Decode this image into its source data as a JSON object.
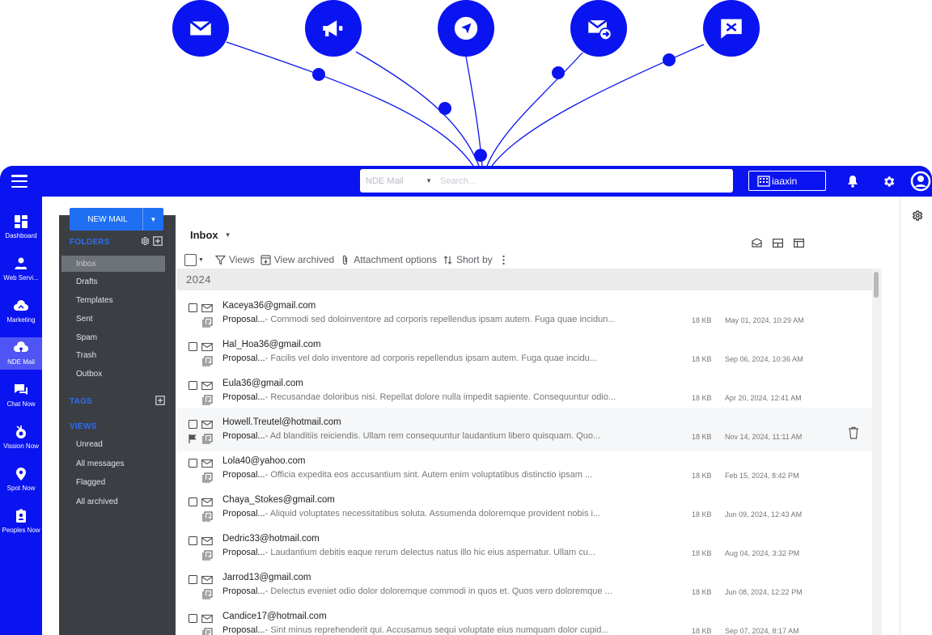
{
  "topbar": {
    "search_module": "NDE Mail",
    "search_placeholder": "Search...",
    "org_name": "iaaxin"
  },
  "nav": {
    "items": [
      {
        "label": "Dashboard",
        "icon": "dashboard-icon"
      },
      {
        "label": "Web Servi...",
        "icon": "web-services-icon"
      },
      {
        "label": "Marketing",
        "icon": "marketing-icon"
      },
      {
        "label": "NDE Mail",
        "icon": "mail-cloud-icon",
        "active": true
      },
      {
        "label": "Chat Now",
        "icon": "chat-icon"
      },
      {
        "label": "Vission Now",
        "icon": "vision-icon"
      },
      {
        "label": "Spot Now",
        "icon": "location-pin-icon"
      },
      {
        "label": "Peoples Now",
        "icon": "people-badge-icon"
      }
    ]
  },
  "folders": {
    "new_mail": "NEW MAIL",
    "folders_title": "FOLDERS",
    "items": [
      "Inbox",
      "Drafts",
      "Templates",
      "Sent",
      "Spam",
      "Trash",
      "Outbox"
    ],
    "tags_title": "TAGS",
    "views_title": "VIEWS",
    "views": [
      "Unread",
      "All messages",
      "Flagged",
      "All archived"
    ]
  },
  "main": {
    "title": "Inbox",
    "toolbar": {
      "views": "Views",
      "view_archived": "View archived",
      "attachment_options": "Attachment options",
      "sort_by": "Short by"
    },
    "year": "2024",
    "messages": [
      {
        "from": "Kaceya36@gmail.com",
        "subject": "Proposal...",
        "preview": "- Commodi sed doloinventore ad corporis repellendus ipsam autem. Fuga quae incidun...",
        "size": "18 KB",
        "date": "May 01, 2024, 10:29 AM"
      },
      {
        "from": "Hal_Hoa36@gmail.com",
        "subject": "Proposal...",
        "preview": "- Facilis vel dolo inventore ad corporis repellendus ipsam autem. Fuga quae incidu...",
        "size": "18 KB",
        "date": "Sep 06, 2024, 10:36 AM"
      },
      {
        "from": "Eula36@gmail.com",
        "subject": "Proposal...",
        "preview": "- Recusandae doloribus nisi. Repellat dolore nulla impedit sapiente. Consequuntur odio...",
        "size": "18 KB",
        "date": "Apr 20, 2024, 12:41 AM"
      },
      {
        "from": "Howell.Treutel@hotmail.com",
        "subject": "Proposal...",
        "preview": "- Ad blanditiis reiciendis. Ullam rem consequuntur laudantium libero quisquam. Quo...",
        "size": "18 KB",
        "date": "Nov 14, 2024, 11:11 AM",
        "hover": true
      },
      {
        "from": "Lola40@yahoo.com",
        "subject": "Proposal...",
        "preview": "- Officia expedita eos accusantium sint. Autem enim voluptatibus distinctio ipsam ...",
        "size": "18 KB",
        "date": "Feb 15, 2024, 8:42 PM"
      },
      {
        "from": "Chaya_Stokes@gmail.com",
        "subject": "Proposal...",
        "preview": "- Aliquid voluptates necessitatibus soluta. Assumenda doloremque provident nobis i...",
        "size": "18 KB",
        "date": "Jun 09, 2024, 12:43 AM"
      },
      {
        "from": "Dedric33@hotmail.com",
        "subject": "Proposal...",
        "preview": "- Laudantium debitis eaque rerum delectus natus illo hic eius aspernatur. Ullam cu...",
        "size": "18 KB",
        "date": "Aug 04, 2024, 3:32 PM"
      },
      {
        "from": "Jarrod13@gmail.com",
        "subject": "Proposal...",
        "preview": "- Delectus eveniet odio dolor doloremque commodi in quos et. Quos vero doloremque ...",
        "size": "18 KB",
        "date": "Jun 08, 2024, 12:22 PM"
      },
      {
        "from": "Candice17@hotmail.com",
        "subject": "Proposal...",
        "preview": "- Sint minus reprehenderit qui. Accusamus sequi voluptate eius numquam dolor cupid...",
        "size": "18 KB",
        "date": "Sep 07, 2024, 8:17 AM"
      }
    ]
  },
  "colors": {
    "brand": "#0a14f0",
    "panel": "#3b3f44",
    "accent": "#1e6ff2"
  }
}
